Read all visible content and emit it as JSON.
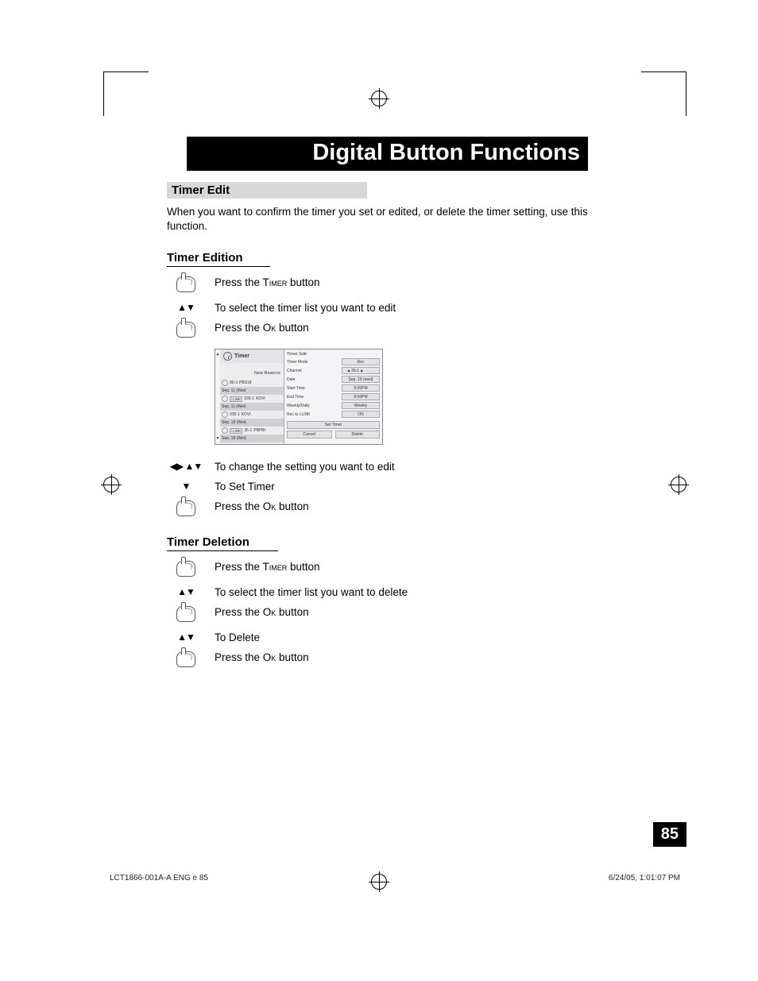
{
  "header": {
    "title": "Digital Button Functions"
  },
  "timer_edit": {
    "heading": "Timer Edit",
    "intro": "When you want to confirm the timer you set or edited, or delete the timer setting, use this function."
  },
  "edition": {
    "heading": "Timer Edition",
    "steps": {
      "s1_pre": "Press the T",
      "s1_sc": "imer",
      "s1_post": " button",
      "s2": "To select the timer list you want to edit",
      "s3_pre": "Press the O",
      "s3_sc": "k",
      "s3_post": " button",
      "s4": "To change the setting you want to edit",
      "s5": "To Set Timer",
      "s6_pre": "Press the O",
      "s6_sc": "k",
      "s6_post": " button"
    }
  },
  "deletion": {
    "heading": "Timer Deletion",
    "steps": {
      "s1_pre": "Press the T",
      "s1_sc": "imer",
      "s1_post": " button",
      "s2": "To select the timer list you want to delete",
      "s3_pre": "Press the O",
      "s3_sc": "k",
      "s3_post": " button",
      "s4": "To Delete",
      "s5_pre": "Press the O",
      "s5_sc": "k",
      "s5_post": " button"
    }
  },
  "osd": {
    "panel_title": "Timer",
    "new_reserve": "New Reserve",
    "list": [
      {
        "badge": "",
        "ch": "80-3",
        "name": "PBS18"
      },
      {
        "sep": "Sep. 11 (Wed"
      },
      {
        "badge": "i.LINK",
        "ch": "335-1",
        "name": "KDVI"
      },
      {
        "sep": "Sep. 11 (Wed"
      },
      {
        "badge": "",
        "ch": "335-1",
        "name": "KDVI"
      },
      {
        "sep": "Sep. 18 (Wed"
      },
      {
        "badge": "i.LINK",
        "ch": "35-1",
        "name": "PBPBI"
      },
      {
        "sep": "Sep. 18 (Wed"
      }
    ],
    "right": {
      "title": "Timer Edit",
      "rows": [
        {
          "k": "Timer Mode",
          "v": "Rec"
        },
        {
          "k": "Channel",
          "v": "35-1",
          "sel": true
        },
        {
          "k": "Date",
          "v": "Sep. 10 (wed)"
        },
        {
          "k": "Start Time",
          "v": "5:00PM"
        },
        {
          "k": "End Time",
          "v": "8:00PM"
        },
        {
          "k": "Weekly/Daily",
          "v": "Weekly"
        },
        {
          "k": "Rec to i.LINK",
          "v": "ON"
        }
      ],
      "set_timer": "Set Timer",
      "cancel": "Cancel",
      "delete": "Delete"
    }
  },
  "page_number": "85",
  "footer": {
    "left": "LCT1866-001A-A ENG e   85",
    "right": "6/24/05, 1:01:07 PM"
  }
}
